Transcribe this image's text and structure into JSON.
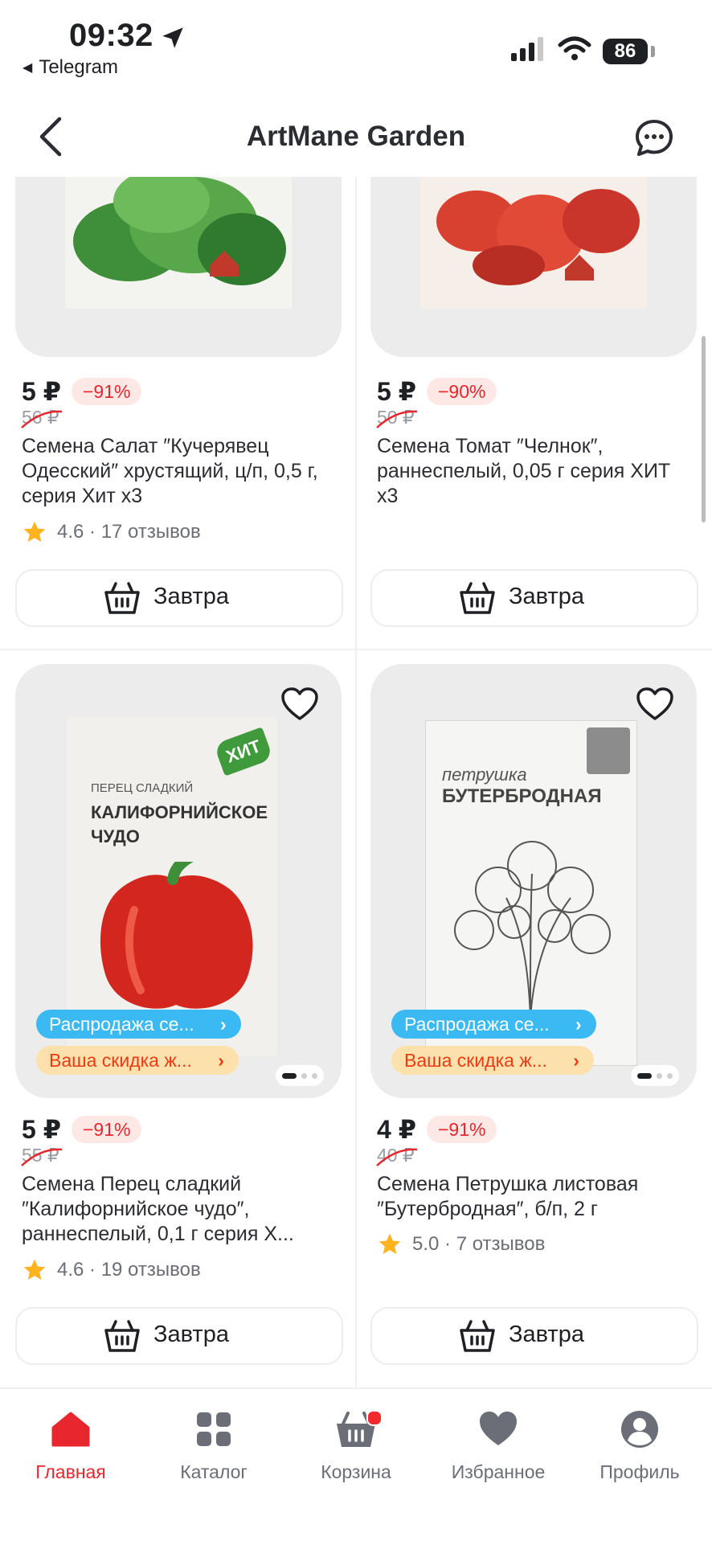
{
  "status_bar": {
    "time": "09:32",
    "back_app": "Telegram",
    "battery": "86"
  },
  "header": {
    "title": "ArtMane Garden"
  },
  "promo": {
    "sale": "Распродажа се...",
    "discount": "Ваша скидка ж..."
  },
  "products": [
    {
      "price": "5 ₽",
      "discount": "−91%",
      "old_price": "56 ₽",
      "name": "Семена Салат ″Кучерявец Одесский″ хрустящий, ц/п, 0,5 г, серия Хит х3",
      "rating": "4.6 · 17 отзывов",
      "delivery": "Завтра",
      "pack_color": "#4f9a45"
    },
    {
      "price": "5 ₽",
      "discount": "−90%",
      "old_price": "50 ₽",
      "name": "Семена Томат ″Челнок″, раннеспелый, 0,05 г серия ХИТ х3",
      "rating": "",
      "delivery": "Завтра",
      "pack_color": "#d6372b"
    },
    {
      "price": "5 ₽",
      "discount": "−91%",
      "old_price": "55 ₽",
      "name": "Семена Перец сладкий ″Калифорнийское чудо″, раннеспелый, 0,1 г серия Х...",
      "rating": "4.6 · 19 отзывов",
      "delivery": "Завтра",
      "pack_color": "#d3261f",
      "pack_subtitle": "ПЕРЕЦ СЛАДКИЙ",
      "pack_title": "КАЛИФОРНИЙСКОЕ ЧУДО",
      "pack_badge": "ХИТ"
    },
    {
      "price": "4 ₽",
      "discount": "−91%",
      "old_price": "40 ₽",
      "name": "Семена Петрушка листовая ″Бутербродная″, б/п, 2 г",
      "rating": "5.0 · 7 отзывов",
      "delivery": "Завтра",
      "pack_color": "#7a7a7a",
      "pack_subtitle": "петрушка",
      "pack_title": "БУТЕРБРОДНАЯ"
    }
  ],
  "tabs": [
    {
      "label": "Главная",
      "icon": "home-icon",
      "active": true
    },
    {
      "label": "Каталог",
      "icon": "catalog-icon",
      "active": false
    },
    {
      "label": "Корзина",
      "icon": "cart-icon",
      "active": false
    },
    {
      "label": "Избранное",
      "icon": "heart-icon",
      "active": false
    },
    {
      "label": "Профиль",
      "icon": "profile-icon",
      "active": false
    }
  ],
  "colors": {
    "accent": "#e8262d",
    "promo_blue": "#3bb9f2",
    "promo_orange_bg": "#fde1ac",
    "star": "#ffb31f"
  }
}
